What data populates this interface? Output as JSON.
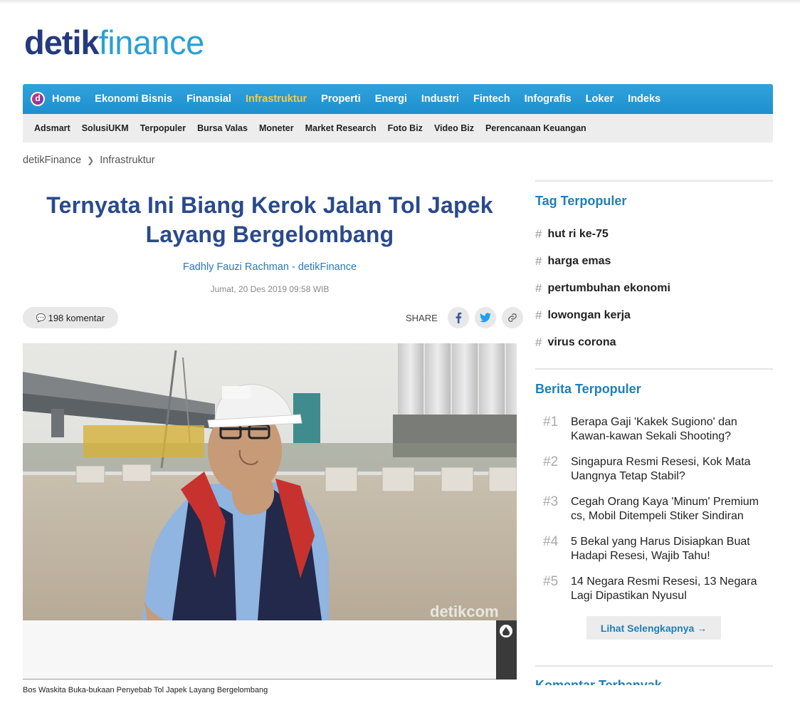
{
  "logo": {
    "part1": "detik",
    "part2": "finance"
  },
  "nav": {
    "icon": "detik-d-icon",
    "items": [
      "Home",
      "Ekonomi Bisnis",
      "Finansial",
      "Infrastruktur",
      "Properti",
      "Energi",
      "Industri",
      "Fintech",
      "Infografis",
      "Loker",
      "Indeks"
    ],
    "active": "Infrastruktur"
  },
  "subnav": [
    "Adsmart",
    "SolusiUKM",
    "Terpopuler",
    "Bursa Valas",
    "Moneter",
    "Market Research",
    "Foto Biz",
    "Video Biz",
    "Perencanaan Keuangan"
  ],
  "breadcrumb": [
    "detikFinance",
    "Infrastruktur"
  ],
  "article": {
    "title": "Ternyata Ini Biang Kerok Jalan Tol Japek Layang Bergelombang",
    "author": "Fadhly Fauzi Rachman - detikFinance",
    "date": "Jumat, 20 Des 2019 09:58 WIB",
    "comments": "198 komentar",
    "share_label": "SHARE",
    "watermark": "detikcom",
    "caption": "Bos Waskita Buka-bukaan Penyebab Tol Japek Layang Bergelombang"
  },
  "sidebar": {
    "tag_title": "Tag Terpopuler",
    "tags": [
      "hut ri ke-75",
      "harga emas",
      "pertumbuhan ekonomi",
      "lowongan kerja",
      "virus corona"
    ],
    "news_title": "Berita Terpopuler",
    "news": [
      {
        "rank": "#1",
        "text": "Berapa Gaji 'Kakek Sugiono' dan Kawan-kawan Sekali Shooting?"
      },
      {
        "rank": "#2",
        "text": "Singapura Resmi Resesi, Kok Mata Uangnya Tetap Stabil?"
      },
      {
        "rank": "#3",
        "text": "Cegah Orang Kaya 'Minum' Premium cs, Mobil Ditempeli Stiker Sindiran"
      },
      {
        "rank": "#4",
        "text": "5 Bekal yang Harus Disiapkan Buat Hadapi Resesi, Wajib Tahu!"
      },
      {
        "rank": "#5",
        "text": "14 Negara Resmi Resesi, 13 Negara Lagi Dipastikan Nyusul"
      }
    ],
    "more": "Lihat Selengkapnya →",
    "next_title": "Komentar Terbanyak"
  },
  "colors": {
    "nav_blue": "#1f8fcf",
    "active": "#ffc93c",
    "title_blue": "#2a4a8c",
    "link_blue": "#1f7fb8"
  }
}
